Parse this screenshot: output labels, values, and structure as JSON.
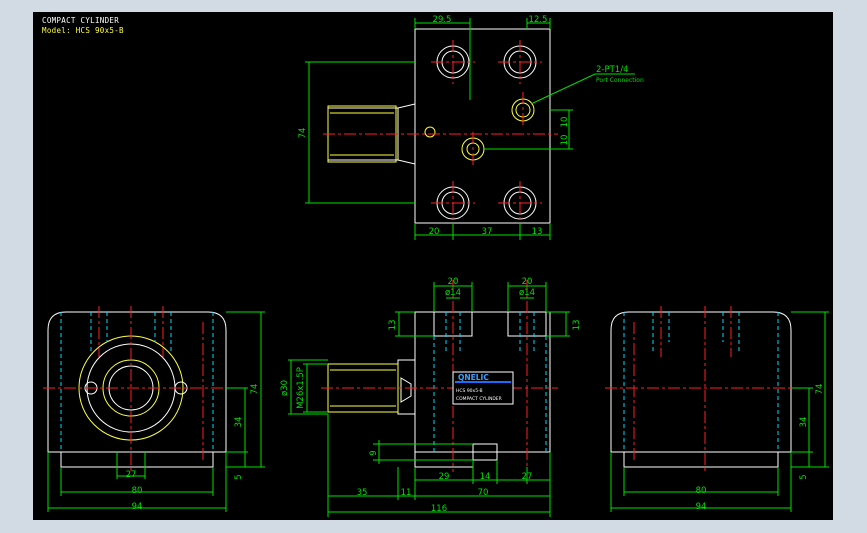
{
  "title_block": {
    "title": "COMPACT CYLINDER",
    "model": "Model: HCS 90x5-B"
  },
  "colors": {
    "background": "#000000",
    "frame": "#d2dae4",
    "outline": "#ffffff",
    "dimension": "#00e000",
    "center_line": "#ff2020",
    "hidden_line": "#00d8ff",
    "thread": "#ffff40"
  },
  "annotations": {
    "port_callout": "2-PT1/4",
    "port_note": "Port Connection",
    "thread_label": "M26x1.5P",
    "brand": "QNELIC",
    "nameplate_model": "HCS 90x5-B",
    "nameplate_title": "COMPACT CYLINDER"
  },
  "dimensions": {
    "top_view": {
      "top_left": "29.5",
      "top_right": "12.5",
      "height": "74",
      "right_upper": "10",
      "right_lower": "10",
      "bottom_left": "20",
      "bottom_mid": "37",
      "bottom_right": "13"
    },
    "left_view": {
      "inner_width": "27",
      "mid_width": "80",
      "outer_width": "94",
      "height": "74",
      "center_height": "34",
      "base": "5"
    },
    "front_view": {
      "port_width_1": "20",
      "port_width_2": "20",
      "port_dia_1": "ø14",
      "port_dia_2": "ø14",
      "port_depth_left": "13",
      "port_depth_right": "13",
      "rod_dia": "ø30",
      "small_height": "9",
      "rod_length": "35",
      "flange": "11",
      "body": "70",
      "overall": "116",
      "seg_29": "29",
      "seg_14": "14",
      "seg_27": "27"
    },
    "right_view": {
      "mid_width": "80",
      "outer_width": "94",
      "height": "74",
      "center_height": "34",
      "base": "5"
    }
  }
}
